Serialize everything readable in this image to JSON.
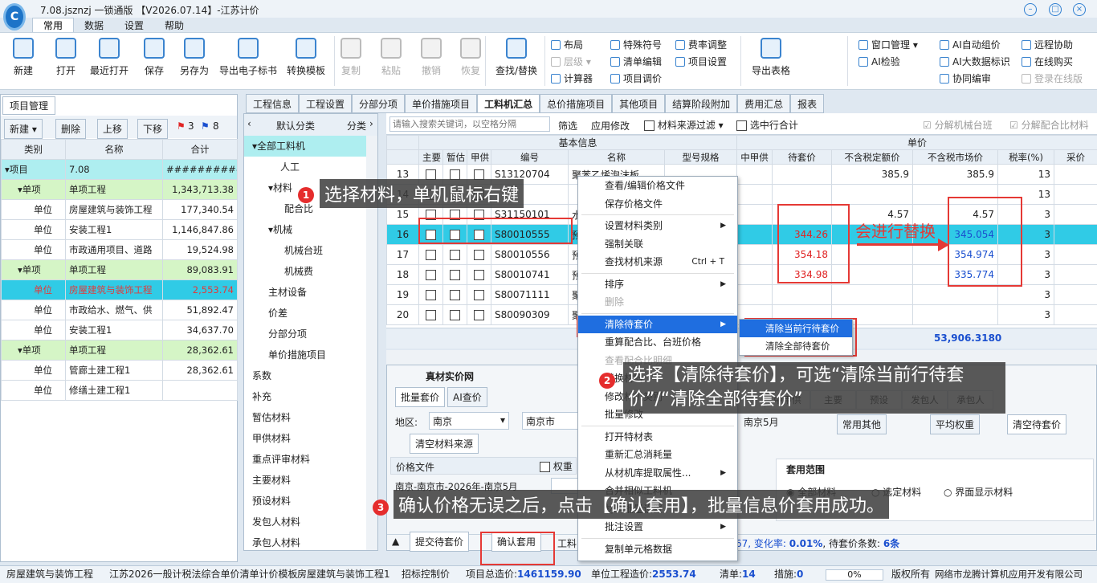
{
  "title": "7.08.jsznzj 一锁通版 【V2026.07.14】-江苏计价",
  "logo": "C",
  "menu": [
    "常用",
    "数据",
    "设置",
    "帮助"
  ],
  "toolbar": {
    "new": "新建",
    "open": "打开",
    "recent": "最近打开",
    "save": "保存",
    "saveas": "另存为",
    "export_bid": "导出电子标书",
    "convert": "转换模板",
    "copy": "复制",
    "paste": "粘贴",
    "undo": "撤销",
    "redo": "恢复",
    "find": "查找/替换",
    "layout": "布局",
    "level": "层级",
    "calculator": "计算器",
    "special": "特殊符号",
    "list_edit": "清单编辑",
    "project_price": "项目调价",
    "fee_adjust": "费率调整",
    "project_settings": "项目设置",
    "export_table": "导出表格",
    "window": "窗口管理",
    "ai_check": "AI检验",
    "ai_price": "AI自动组价",
    "ai_bigdata": "AI大数据标识",
    "collab": "协同编审",
    "remote": "远程协助",
    "online_buy": "在线购买",
    "login_online": "登录在线版"
  },
  "left": {
    "tab": "项目管理",
    "btn_new": "新建",
    "btn_del": "删除",
    "btn_up": "上移",
    "btn_down": "下移",
    "flag_red": "3",
    "flag_blue": "8",
    "cols": [
      "类别",
      "名称",
      "合计"
    ],
    "rows": [
      {
        "cat": "▾项目",
        "name": "7.08",
        "total": "###########",
        "type": "root"
      },
      {
        "cat": "▾单项",
        "name": "单项工程",
        "total": "1,343,713.38",
        "type": "single"
      },
      {
        "cat": "单位",
        "name": "房屋建筑与装饰工程",
        "total": "177,340.54",
        "type": "unit"
      },
      {
        "cat": "单位",
        "name": "安装工程1",
        "total": "1,146,847.86",
        "type": "unit"
      },
      {
        "cat": "单位",
        "name": "市政通用项目、道路",
        "total": "19,524.98",
        "type": "unit"
      },
      {
        "cat": "▾单项",
        "name": "单项工程",
        "total": "89,083.91",
        "type": "single"
      },
      {
        "cat": "单位",
        "name": "房屋建筑与装饰工程",
        "total": "2,553.74",
        "type": "sel"
      },
      {
        "cat": "单位",
        "name": "市政给水、燃气、供",
        "total": "51,892.47",
        "type": "unit"
      },
      {
        "cat": "单位",
        "name": "安装工程1",
        "total": "34,637.70",
        "type": "unit"
      },
      {
        "cat": "▾单项",
        "name": "单项工程",
        "total": "28,362.61",
        "type": "single"
      },
      {
        "cat": "单位",
        "name": "管廊土建工程1",
        "total": "28,362.61",
        "type": "unit"
      },
      {
        "cat": "单位",
        "name": "修缮土建工程1",
        "total": "",
        "type": "unit"
      }
    ]
  },
  "tabs": [
    "工程信息",
    "工程设置",
    "分部分项",
    "单价措施项目",
    "工料机汇总",
    "总价措施项目",
    "其他项目",
    "结算阶段附加",
    "费用汇总",
    "报表"
  ],
  "tree": {
    "head": "默认分类",
    "head2": "分类",
    "items": [
      "▾全部工料机",
      "人工",
      "▾材料",
      "配合比",
      "▾机械",
      "机械台班",
      "机械费",
      "主材设备",
      "价差",
      "分部分项",
      "单价措施项目",
      "系数",
      "补充",
      "暂估材料",
      "甲供材料",
      "重点评审材料",
      "主要材料",
      "预设材料",
      "发包人材料",
      "承包人材料"
    ]
  },
  "filter": {
    "search_placeholder": "请输入搜索关键词，以空格分隔",
    "btn_filter": "筛选",
    "btn_apply": "应用修改",
    "source_filter": "材料来源过滤",
    "sel_total": "选中行合计",
    "split_machine": "分解机械台班",
    "split_mix": "分解配合比材料"
  },
  "grid": {
    "group1": "基本信息",
    "group2": "单价",
    "cols": [
      "主要",
      "暂估",
      "甲供",
      "编号",
      "名称",
      "型号规格",
      "中甲供",
      "待套价",
      "不含税定额价",
      "不含税市场价",
      "税率(%)",
      "采价"
    ],
    "rows": [
      {
        "no": "13",
        "code": "S13120704",
        "name": "聚苯乙烯泡沫板",
        "pend": "",
        "quota": "385.9",
        "market": "385.9",
        "tax": "13"
      },
      {
        "no": "14",
        "code": "",
        "name": "",
        "pend": "",
        "quota": "",
        "market": "",
        "tax": "13"
      },
      {
        "no": "15",
        "code": "S31150101",
        "name": "水",
        "pend": "",
        "quota": "4.57",
        "market": "4.57",
        "tax": "3"
      },
      {
        "no": "16",
        "code": "S80010555",
        "name": "预",
        "pend": "344.26",
        "quota": "",
        "market": "345.054",
        "tax": "3"
      },
      {
        "no": "17",
        "code": "S80010556",
        "name": "预",
        "pend": "354.18",
        "quota": "",
        "market": "354.974",
        "tax": "3"
      },
      {
        "no": "18",
        "code": "S80010741",
        "name": "预",
        "pend": "334.98",
        "quota": "",
        "market": "335.774",
        "tax": "3"
      },
      {
        "no": "19",
        "code": "S80071111",
        "name": "聚",
        "pend": "",
        "quota": "",
        "market": "",
        "tax": "3"
      },
      {
        "no": "20",
        "code": "S80090309",
        "name": "聚",
        "pend": "",
        "quota": "",
        "market": "",
        "tax": "3"
      }
    ],
    "sum": "53,906.3180"
  },
  "ctx": {
    "items": [
      "查看/编辑价格文件",
      "保存价格文件",
      "设置材料类别",
      "强制关联",
      "查找材机来源",
      "排序",
      "删除",
      "清除待套价",
      "重算配合比、台班价格",
      "查看配合比明细",
      "替换材料",
      "修改材机类别",
      "批量修改",
      "打开特材表",
      "重新汇总消耗量",
      "从材机库提取属性...",
      "合并相似工料机",
      "材料批量设置",
      "批注设置",
      "复制单元格数据"
    ],
    "shortcut": "Ctrl + T",
    "sub": [
      "清除当前行待套价",
      "清除全部待套价"
    ]
  },
  "bottom": {
    "title": "真材实价网",
    "tab1": "批量套价",
    "tab2": "AI查价",
    "region_label": "地区:",
    "region": "南京",
    "city": "南京市",
    "date": "南京5月",
    "btn_clear_src": "清空材料来源",
    "price_file_h": "价格文件",
    "weight_h": "权重",
    "op_h": "操作",
    "price_file": "南京-南京市-2026年-南京5月",
    "btn_submit": "提交待套价",
    "btn_confirm": "确认套用",
    "gongliao": "工料",
    "right_tabs": [
      "中甲供",
      "主要",
      "预设",
      "发包人",
      "承包人"
    ],
    "btn_usual": "常用其他",
    "btn_avg": "平均权重",
    "btn_clear_pend": "清空待套价",
    "scope_h": "套用范围",
    "scope": [
      "全部材料",
      "选定材料",
      "界面显示材料"
    ],
    "info_prefix": "67, 变化率: ",
    "change": "0.01%",
    "info_mid": ", 待套价条数: ",
    "count": "6条",
    "jiage": "价格"
  },
  "ann": {
    "a1": "选择材料，单机鼠标右键",
    "a2": "选择【清除待套价】，可选“清除当前行待套价”/“清除全部待套价”",
    "a3": "确认价格无误之后，点击【确认套用】，批量信息价套用成功。",
    "a4": "会进行替换"
  },
  "status": {
    "s1": "房屋建筑与装饰工程",
    "s2": "江苏2026一般计税法综合单价清单计价模板",
    "s3": "房屋建筑与装饰工程1",
    "s4": "招标控制价",
    "s5_l": "项目总造价:",
    "s5_v": "1461159.90",
    "s6_l": "单位工程造价:",
    "s6_v": "2553.74",
    "s7_l": "清单:",
    "s7_v": "14",
    "s8_l": "措施:",
    "s8_v": "0",
    "pct": "0%",
    "rights": "版权所有",
    "company": "网络市龙腾计算机应用开发有限公司"
  }
}
